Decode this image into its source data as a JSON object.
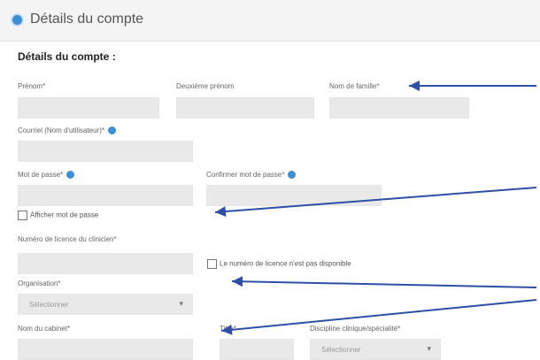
{
  "header": {
    "title": "Détails du compte"
  },
  "section": {
    "title": "Détails du compte :"
  },
  "fields": {
    "first_name_label": "Prénom*",
    "middle_name_label": "Deuxième prénom",
    "last_name_label": "Nom de famille*",
    "email_label": "Courriel (Nom d'utilisateur)*",
    "password_label": "Mot de passe*",
    "confirm_password_label": "Confirmer mot de passe*",
    "show_password_label": "Afficher mot de passe",
    "license_label": "Numéro de licence du clinicien*",
    "license_unavailable_label": "Le numéro de licence n'est pas disponible",
    "organization_label": "Organisation*",
    "organization_value": "Sélectionner",
    "practice_name_label": "Nom du cabinet*",
    "title_label": "Titre*",
    "discipline_label": "Discipline clinique/spécialité*",
    "discipline_value": "Sélectionner"
  },
  "colors": {
    "accent": "#3d8fd4",
    "arrow": "#2d4fa6",
    "field_bg": "#e9e9e9"
  }
}
